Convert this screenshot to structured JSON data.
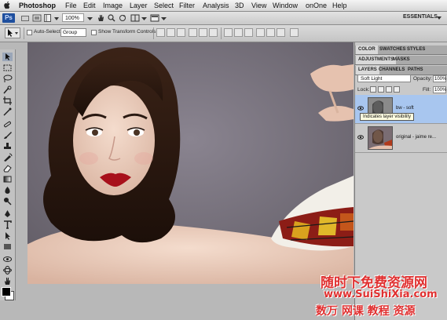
{
  "menubar": {
    "app": "Photoshop",
    "items": [
      "File",
      "Edit",
      "Image",
      "Layer",
      "Select",
      "Filter",
      "Analysis",
      "3D",
      "View",
      "Window",
      "onOne",
      "Help"
    ]
  },
  "appbar": {
    "logo": "Ps",
    "zoom": "100%",
    "workspace": "ESSENTIALS"
  },
  "options": {
    "auto_select_label": "Auto-Select:",
    "auto_select_value": "Group",
    "show_transform_label": "Show Transform Controls"
  },
  "panels": {
    "top_tabs": [
      "COLOR",
      "SWATCHES",
      "STYLES"
    ],
    "adj_tabs": [
      "ADJUSTMENTS",
      "MASKS"
    ],
    "layer_tabs": [
      "LAYERS",
      "CHANNELS",
      "PATHS"
    ],
    "blend_mode": "Soft Light",
    "opacity_label": "Opacity:",
    "opacity_value": "100%",
    "lock_label": "Lock:",
    "fill_label": "Fill:",
    "fill_value": "100%",
    "layers": [
      {
        "name": "bw - soft",
        "selected": true
      },
      {
        "name": "original - jaime re...",
        "selected": false
      }
    ],
    "tooltip": "Indicates layer visibility"
  },
  "watermark": {
    "line1": "随时下免费资源网",
    "line2": "www.SuiShiXia.com",
    "line3": "数万 网课 教程 资源"
  },
  "colors": {
    "accent": "#3b6fc6",
    "selected_layer": "#a8c6ef",
    "watermark": "#e03030"
  }
}
